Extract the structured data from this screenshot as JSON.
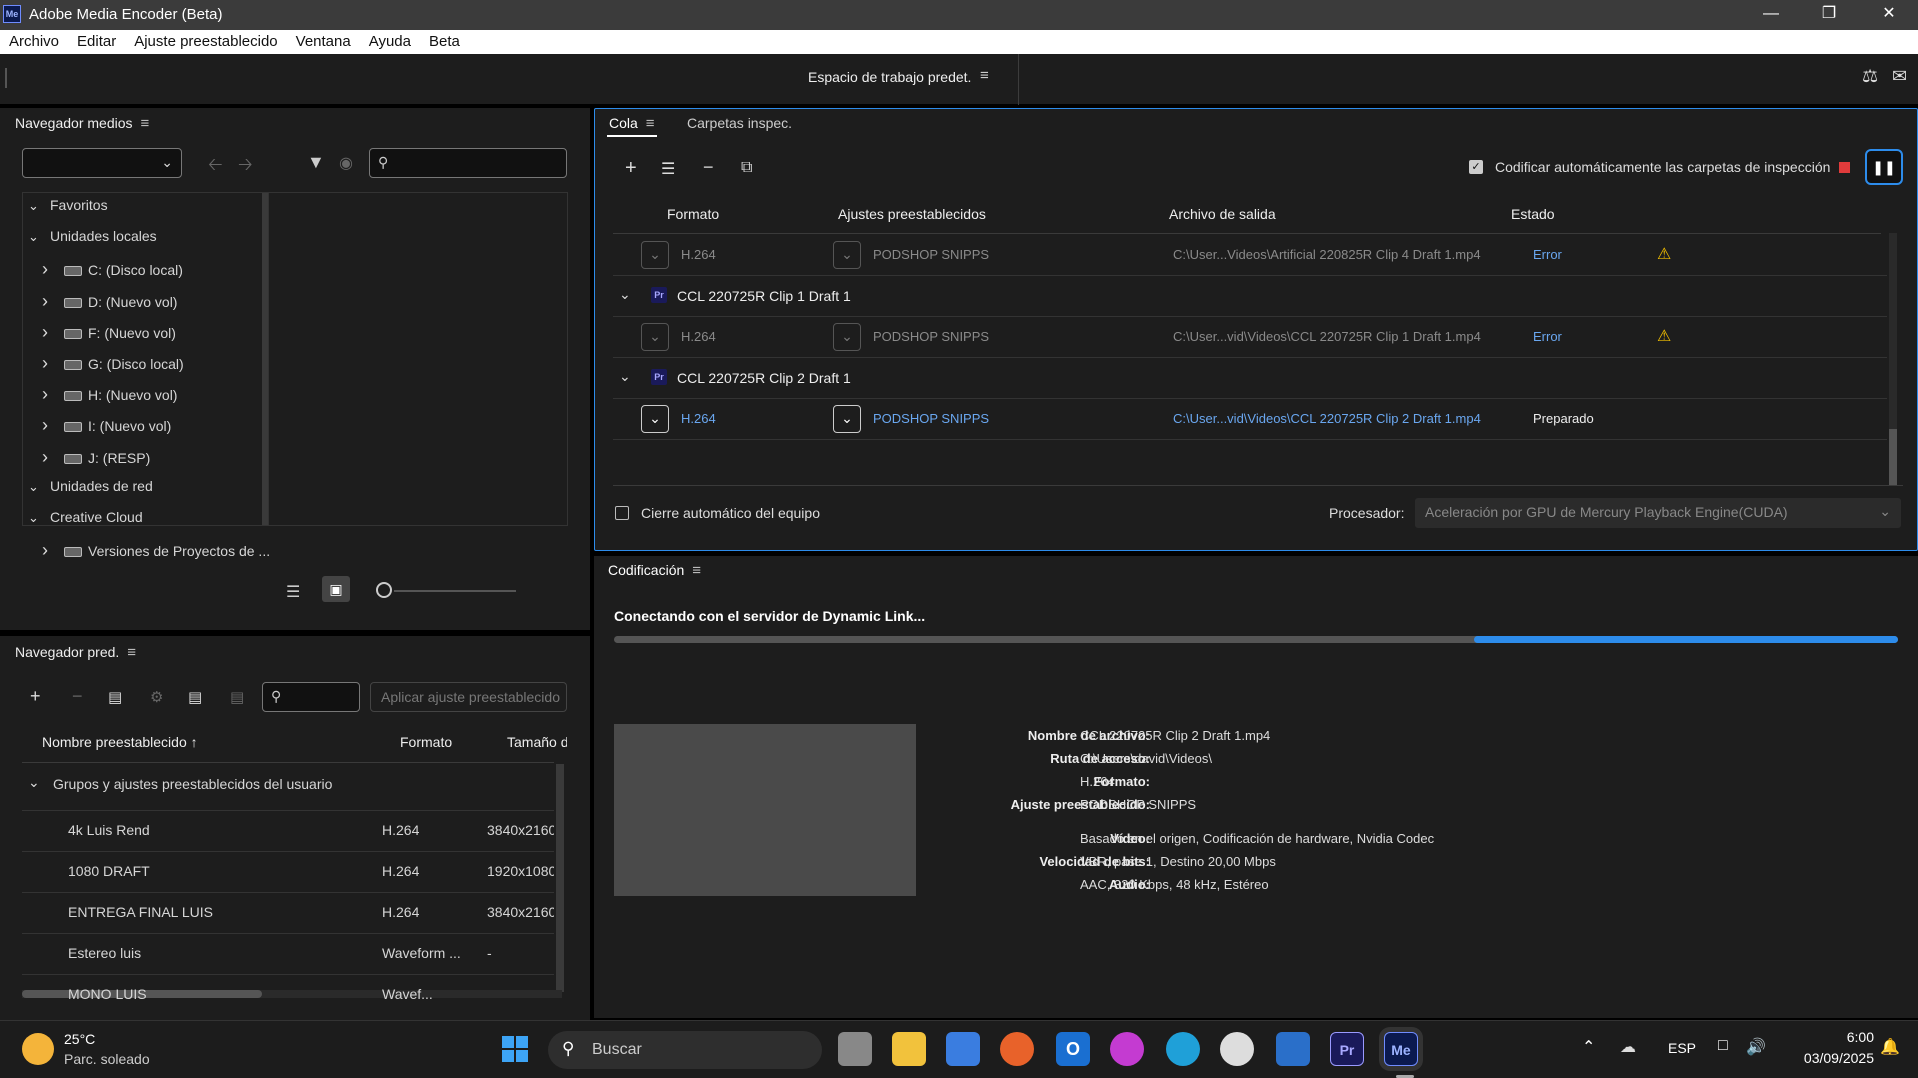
{
  "window": {
    "title": "Adobe Media Encoder (Beta)",
    "app_icon": "Me",
    "controls": [
      "minimize-icon",
      "restore-icon",
      "close-icon"
    ]
  },
  "menu": [
    "Archivo",
    "Editar",
    "Ajuste preestablecido",
    "Ventana",
    "Ayuda",
    "Beta"
  ],
  "toolbar": {
    "workspace": "Espacio de trabajo predet."
  },
  "media_browser": {
    "title": "Navegador medios",
    "search_placeholder": "",
    "tree": [
      {
        "label": "Favoritos",
        "expanded": true,
        "level": 0
      },
      {
        "label": "Unidades locales",
        "expanded": true,
        "level": 0
      },
      {
        "label": "C: (Disco local)",
        "level": 1
      },
      {
        "label": "D: (Nuevo vol)",
        "level": 1
      },
      {
        "label": "F: (Nuevo vol)",
        "level": 1
      },
      {
        "label": "G: (Disco local)",
        "level": 1
      },
      {
        "label": "H: (Nuevo vol)",
        "level": 1
      },
      {
        "label": "I: (Nuevo vol)",
        "level": 1
      },
      {
        "label": "J: (RESP)",
        "level": 1
      },
      {
        "label": "Unidades de red",
        "expanded": true,
        "level": 0
      },
      {
        "label": "Creative Cloud",
        "expanded": true,
        "level": 0
      },
      {
        "label": "Versiones de Proyectos de ...",
        "level": 1
      }
    ]
  },
  "preset_browser": {
    "title": "Navegador pred.",
    "apply_placeholder": "Aplicar ajuste preestablecido",
    "columns": [
      "Nombre preestablecido",
      "Formato",
      "Tamaño d"
    ],
    "group": "Grupos y ajustes preestablecidos del usuario",
    "rows": [
      {
        "name": "4k Luis Rend",
        "format": "H.264",
        "size": "3840x2160"
      },
      {
        "name": "1080 DRAFT",
        "format": "H.264",
        "size": "1920x1080"
      },
      {
        "name": "ENTREGA FINAL LUIS",
        "format": "H.264",
        "size": "3840x2160"
      },
      {
        "name": "Estereo luis",
        "format": "Waveform ...",
        "size": "-"
      },
      {
        "name": "MONO LUIS",
        "format": "Wavef...",
        "size": ""
      }
    ]
  },
  "queue": {
    "tabs": [
      "Cola",
      "Carpetas inspec."
    ],
    "auto_encode_label": "Codificar automáticamente las carpetas de inspección",
    "columns": [
      "Formato",
      "Ajustes preestablecidos",
      "Archivo de salida",
      "Estado"
    ],
    "items": [
      {
        "type": "output",
        "format": "H.264",
        "preset": "PODSHOP SNIPPS",
        "output": "C:\\User...Videos\\Artificial 220825R Clip 4 Draft 1.mp4",
        "status": "Error",
        "warning": true,
        "active": false
      },
      {
        "type": "source",
        "name": "CCL 220725R Clip 1 Draft 1"
      },
      {
        "type": "output",
        "format": "H.264",
        "preset": "PODSHOP SNIPPS",
        "output": "C:\\User...vid\\Videos\\CCL 220725R Clip 1 Draft 1.mp4",
        "status": "Error",
        "warning": true,
        "active": false
      },
      {
        "type": "source",
        "name": "CCL 220725R Clip 2 Draft 1"
      },
      {
        "type": "output",
        "format": "H.264",
        "preset": "PODSHOP SNIPPS",
        "output": "C:\\User...vid\\Videos\\CCL 220725R Clip 2 Draft 1.mp4",
        "status": "Preparado",
        "warning": false,
        "active": true
      }
    ],
    "auto_shutdown_label": "Cierre automático del equipo",
    "processor_label": "Procesador:",
    "processor_value": "Aceleración por GPU de Mercury Playback Engine(CUDA)"
  },
  "encoding": {
    "title": "Codificación",
    "status": "Conectando con el servidor de Dynamic Link...",
    "progress_fraction_start": 0.67,
    "details": [
      {
        "label": "Nombre de archivo:",
        "value": "CCL 220725R Clip 2 Draft 1.mp4"
      },
      {
        "label": "Ruta de acceso:",
        "value": "C:\\Users\\david\\Videos\\"
      },
      {
        "label": "Formato:",
        "value": "H.264"
      },
      {
        "label": "Ajuste preestablecido:",
        "value": "PODSHOP SNIPPS"
      },
      {
        "label": "Vídeo:",
        "value": "Basado en el origen, Codificación de hardware, Nvidia Codec"
      },
      {
        "label": "Velocidad de bits:",
        "value": "VBR, pase 1, Destino 20,00 Mbps"
      },
      {
        "label": "Audio:",
        "value": "AAC, 320 Kbps, 48 kHz, Estéreo"
      }
    ]
  },
  "taskbar": {
    "weather_temp": "25°C",
    "weather_desc": "Parc. soleado",
    "search_placeholder": "Buscar",
    "lang": "ESP",
    "time": "6:00",
    "date": "03/09/2025"
  },
  "colors": {
    "accent": "#2d8ceb",
    "error": "#6aa7f0",
    "warning": "#f4c000",
    "stop": "#e03b3b"
  }
}
